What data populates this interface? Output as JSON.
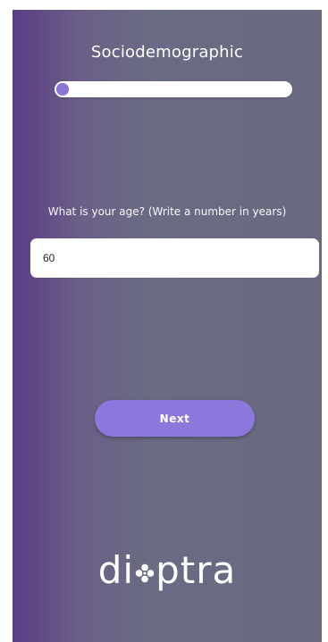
{
  "header": {
    "title": "Sociodemographic"
  },
  "progress": {
    "fraction": 0.03
  },
  "question": {
    "text": "What is your age? (Write a number in years)"
  },
  "answer_input": {
    "value": "60"
  },
  "actions": {
    "next_label": "Next"
  },
  "brand": {
    "logo_text": "dioptra",
    "logo_prefix": "di",
    "logo_suffix": "ptra",
    "logo_mark": "flower-icon"
  },
  "colors": {
    "accent": "#8c78dc",
    "background_left": "#5b3d86",
    "background_right": "#696a80",
    "surface": "#ffffff"
  }
}
